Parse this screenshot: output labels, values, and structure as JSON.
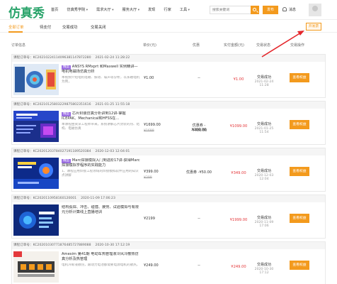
{
  "header": {
    "logo": "仿真秀",
    "nav": [
      "首页",
      "仿真秀学院",
      "需求大厅",
      "服务大厅",
      "发现",
      "行家",
      "工具"
    ],
    "search_placeholder": "搜索关键词",
    "release_label": "发布",
    "messages_label": "消息",
    "accent_color": "#f39a1d"
  },
  "tabs": {
    "items": [
      "全部订单",
      "待支付",
      "交易成功",
      "交易关闭"
    ],
    "invoice_label": "开发票"
  },
  "table_header": {
    "order_info": "订单信息",
    "unit_price": "单价(元)",
    "discount": "优惠",
    "paid": "实付金额(元)",
    "status": "交易状态",
    "operation": "交易操作"
  },
  "orders": [
    {
      "order_no": "课程订单号：KC20210224114096381147872280",
      "time": "2021-02-24 11:28:22",
      "badge": "精品",
      "title": "ANSYS RMxprt 和Maxwell 实例精讲—电机电磁场仿真分析",
      "desc": "本视频介绍电机电磁、振动、噪声等分析，以永磁电机为例，",
      "price": "¥1.00",
      "price_old": "",
      "discount1": "--",
      "discount2": "",
      "paid": "¥1.00",
      "status": "交易成功",
      "status_date": "2021-02-24 11:28",
      "op": "查看权益"
    },
    {
      "order_no": "课程订单号：KC20210125803229875802351616",
      "time": "2021-01-25 11:55:18",
      "badge": "精品",
      "title": "芯片封装仿真分析讲到12讲-掌握ICEPAK、Mechanical和HFSS在...",
      "desc": "本课程由资深工程师带来，系统讲解芯片封装的热、结构、电磁仿真",
      "price": "¥1699.00",
      "price_old": "¥1699",
      "discount1": "优惠券 -¥200.00",
      "discount2": "-¥400.00",
      "paid": "¥1099.00",
      "status": "交易成功",
      "status_date": "2021-01-25 11:54",
      "op": "查看权益"
    },
    {
      "order_no": "课程订单号：KC20201203784027191189520384",
      "time": "2020-12-03 12:04:01",
      "badge": "精品",
      "title": "Marc焊接模拟入门到进阶17讲-获得Marc焊接模拟学程序的实践能力",
      "desc": "1、课程应用焊接工程领域的焊接模拟软件应用的知识点讲解",
      "price": "¥399.00",
      "price_old": "¥399",
      "discount1": "优惠券 -¥50.00",
      "discount2": "",
      "paid": "¥349.00",
      "status": "交易成功",
      "status_date": "2020-12-03 12:04",
      "op": "查看权益"
    },
    {
      "order_no": "课程订单号：KC2020110958160120001",
      "time": "2020-11-09 17:06:23",
      "badge": "",
      "title": "结构弧焊、冲击、碰撞、疲劳、试验模拟与有限元分析计算线上直播培训",
      "desc": "",
      "price": "¥2199",
      "price_old": "",
      "discount1": "--",
      "discount2": "",
      "paid": "¥1999.00",
      "status": "交易成功",
      "status_date": "2020-11-09 17:06",
      "op": "查看权益"
    },
    {
      "order_no": "课程订单号：KC20201030771876485727889088",
      "time": "2020-10-30 17:12:19",
      "badge": "",
      "title": "Amesim 第41期 电动车热管理液冷风冷散热仿真分析及热管理",
      "desc": "电机冷却液散热，跟动力电池都需要电源电机的散热，",
      "price": "¥249.00",
      "price_old": "",
      "discount1": "--",
      "discount2": "",
      "paid": "¥249.00",
      "status": "交易成功",
      "status_date": "2020-10-30 17:12",
      "op": "查看权益"
    }
  ]
}
